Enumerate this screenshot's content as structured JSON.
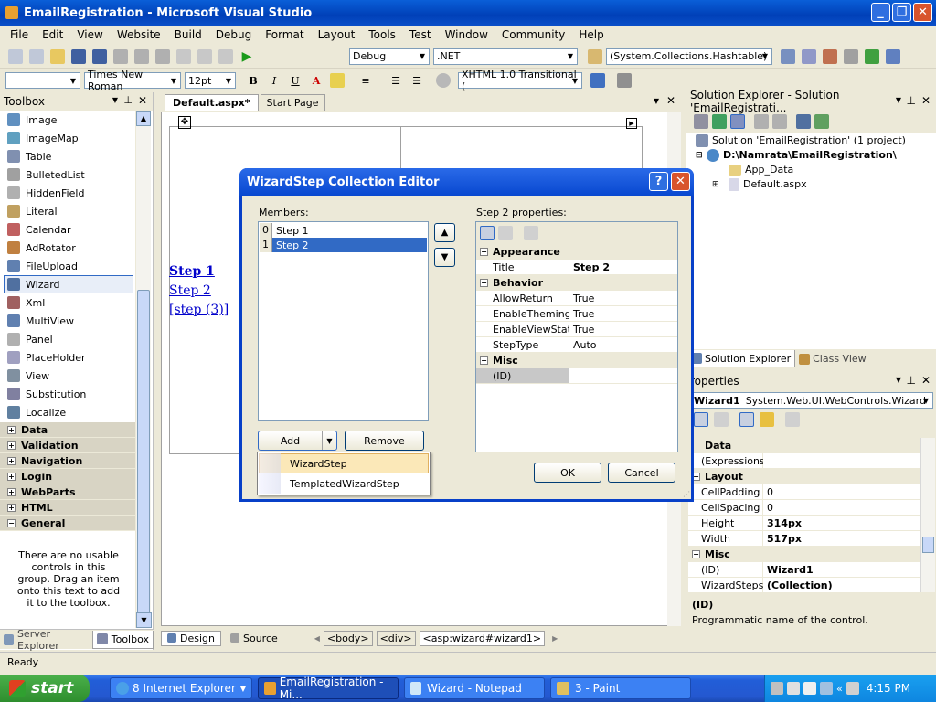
{
  "window": {
    "title": "EmailRegistration - Microsoft Visual Studio"
  },
  "menu": [
    "File",
    "Edit",
    "View",
    "Website",
    "Build",
    "Debug",
    "Format",
    "Layout",
    "Tools",
    "Test",
    "Window",
    "Community",
    "Help"
  ],
  "toolbar1": {
    "config": "Debug",
    "platform": ".NET",
    "object": "(System.Collections.Hashtable)"
  },
  "toolbar2": {
    "block": "",
    "font": "Times New Roman",
    "size": "12pt",
    "schema": "XHTML 1.0 Transitional ("
  },
  "toolbox": {
    "title": "Toolbox",
    "items": [
      "Image",
      "ImageMap",
      "Table",
      "BulletedList",
      "HiddenField",
      "Literal",
      "Calendar",
      "AdRotator",
      "FileUpload",
      "Wizard",
      "Xml",
      "MultiView",
      "Panel",
      "PlaceHolder",
      "View",
      "Substitution",
      "Localize"
    ],
    "categories": [
      {
        "pm": "+",
        "label": "Data"
      },
      {
        "pm": "+",
        "label": "Validation"
      },
      {
        "pm": "+",
        "label": "Navigation"
      },
      {
        "pm": "+",
        "label": "Login"
      },
      {
        "pm": "+",
        "label": "WebParts"
      },
      {
        "pm": "+",
        "label": "HTML"
      },
      {
        "pm": "−",
        "label": "General"
      }
    ],
    "empty_text": "There are no usable controls in this group. Drag an item onto this text to add it to the toolbox.",
    "bottom_tabs": [
      "Server Explorer",
      "Toolbox"
    ]
  },
  "editor": {
    "tabs": [
      "Default.aspx*",
      "Start Page"
    ],
    "links": [
      "Step 1",
      "Step 2",
      "[step (3)]"
    ],
    "view_tabs": [
      "Design",
      "Source"
    ],
    "breadcrumb": [
      "<body>",
      "<div>",
      "<asp:wizard#wizard1>"
    ]
  },
  "dialog": {
    "title": "WizardStep Collection Editor",
    "members_label": "Members:",
    "members": [
      {
        "idx": "0",
        "name": "Step 1"
      },
      {
        "idx": "1",
        "name": "Step 2"
      }
    ],
    "props_label": "Step 2 properties:",
    "categories": [
      {
        "name": "Appearance",
        "rows": [
          {
            "k": "Title",
            "v": "Step 2",
            "bold": true
          }
        ]
      },
      {
        "name": "Behavior",
        "rows": [
          {
            "k": "AllowReturn",
            "v": "True"
          },
          {
            "k": "EnableTheming",
            "v": "True"
          },
          {
            "k": "EnableViewState",
            "v": "True"
          },
          {
            "k": "StepType",
            "v": "Auto"
          }
        ]
      },
      {
        "name": "Misc",
        "rows": [
          {
            "k": "(ID)",
            "v": ""
          }
        ]
      }
    ],
    "add": "Add",
    "remove": "Remove",
    "ok": "OK",
    "cancel": "Cancel",
    "dropdown": [
      "WizardStep",
      "TemplatedWizardStep"
    ]
  },
  "solution": {
    "title": "Solution Explorer - Solution 'EmailRegistrati...",
    "nodes": [
      "Solution 'EmailRegistration' (1 project)",
      "D:\\Namrata\\EmailRegistration\\",
      "App_Data",
      "Default.aspx"
    ],
    "tabs": [
      "Solution Explorer",
      "Class View"
    ]
  },
  "properties": {
    "title": "roperties",
    "object": "Wizard1",
    "type": "System.Web.UI.WebControls.Wizard",
    "groups": [
      {
        "name": "Data",
        "rows": [
          {
            "k": "(Expressions)",
            "v": ""
          }
        ]
      },
      {
        "name": "Layout",
        "rows": [
          {
            "k": "CellPadding",
            "v": "0"
          },
          {
            "k": "CellSpacing",
            "v": "0"
          },
          {
            "k": "Height",
            "v": "314px",
            "bold": true
          },
          {
            "k": "Width",
            "v": "517px",
            "bold": true
          }
        ]
      },
      {
        "name": "Misc",
        "rows": [
          {
            "k": "(ID)",
            "v": "Wizard1",
            "bold": true
          },
          {
            "k": "WizardSteps",
            "v": "(Collection)",
            "bold": true
          }
        ]
      }
    ],
    "desc_title": "(ID)",
    "desc_text": "Programmatic name of the control."
  },
  "status": "Ready",
  "taskbar": {
    "start": "start",
    "tasks": [
      "8 Internet Explorer",
      "EmailRegistration - Mi...",
      "Wizard - Notepad",
      "3 - Paint"
    ],
    "clock": "4:15 PM"
  }
}
